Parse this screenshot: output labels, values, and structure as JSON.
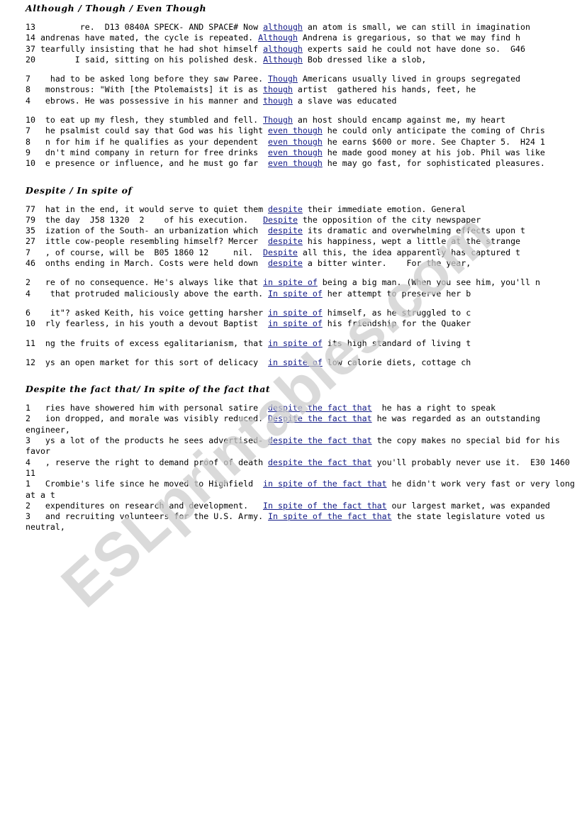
{
  "watermark": {
    "text": "ESLprintables.com",
    "color": "#cdcdcd"
  },
  "colors": {
    "keyword": "#121a86",
    "text": "#000000",
    "background": "#ffffff"
  },
  "sections": [
    {
      "title": "Although / Though / Even Though",
      "groups": [
        {
          "lines": [
            {
              "num": "13",
              "left": "         re.  D13 0840A SPECK- AND SPACE# Now ",
              "kw": "although",
              "right": " an atom is small, we can still in imagination"
            },
            {
              "num": "14",
              "left": " andrenas have mated, the cycle is repeated. ",
              "kw": "Although",
              "right": " Andrena is gregarious, so that we may find h"
            },
            {
              "num": "37",
              "left": " tearfully insisting that he had shot himself ",
              "kw": "although",
              "right": " experts said he could not have done so.  G46"
            },
            {
              "num": "20",
              "left": "        I said, sitting on his polished desk. ",
              "kw": "Although",
              "right": " Bob dressed like a slob,"
            }
          ]
        },
        {
          "lines": [
            {
              "num": "7",
              "left": "    had to be asked long before they saw Paree. ",
              "kw": "Though",
              "right": " Americans usually lived in groups segregated"
            },
            {
              "num": "8",
              "left": "   monstrous: \"With [the Ptolemaists] it is as ",
              "kw": "though",
              "right": " artist  gathered his hands, feet, he"
            },
            {
              "num": "4",
              "left": "   ebrows. He was possessive in his manner and ",
              "kw": "though",
              "right": " a slave was educated"
            }
          ]
        },
        {
          "lines": [
            {
              "num": "10",
              "left": "  to eat up my flesh, they stumbled and fell. ",
              "kw": "Though",
              "right": " an host should encamp against me, my heart"
            },
            {
              "num": "7",
              "left": "   he psalmist could say that God was his light ",
              "kw": "even though",
              "right": " he could only anticipate the coming of Chris"
            },
            {
              "num": "8",
              "left": "   n for him if he qualifies as your dependent  ",
              "kw": "even though",
              "right": " he earns $600 or more. See Chapter 5.  H24 1"
            },
            {
              "num": "9",
              "left": "   dn't mind company in return for free drinks  ",
              "kw": "even though",
              "right": " he made good money at his job. Phil was like"
            },
            {
              "num": "10",
              "left": "  e presence or influence, and he must go far  ",
              "kw": "even though",
              "right": " he may go fast, for sophisticated pleasures."
            }
          ]
        }
      ]
    },
    {
      "title": "Despite / In spite of",
      "groups": [
        {
          "lines": [
            {
              "num": "77",
              "left": "  hat in the end, it would serve to quiet them ",
              "kw": "despite",
              "right": " their immediate emotion. General"
            },
            {
              "num": "79",
              "left": "  the day  J58 1320  2    of his execution.   ",
              "kw": "Despite",
              "right": " the opposition of the city newspaper"
            },
            {
              "num": "35",
              "left": "  ization of the South- an urbanization which  ",
              "kw": "despite",
              "right": " its dramatic and overwhelming effects upon t"
            },
            {
              "num": "27",
              "left": "  ittle cow-people resembling himself? Mercer  ",
              "kw": "despite",
              "right": " his happiness, wept a little at the strange"
            },
            {
              "num": "7",
              "left": "   , of course, will be  B05 1860 12     nil.  ",
              "kw": "Despite",
              "right": " all this, the idea apparently has captured t"
            },
            {
              "num": "46",
              "left": "  onths ending in March. Costs were held down  ",
              "kw": "despite",
              "right": " a bitter winter.    For the year,"
            }
          ]
        },
        {
          "lines": [
            {
              "num": "2",
              "left": "   re of no consequence. He's always like that ",
              "kw": "in spite of",
              "right": " being a big man. (When you see him, you'll n"
            },
            {
              "num": "4",
              "left": "    that protruded maliciously above the earth. ",
              "kw": "In spite of",
              "right": " her attempt to preserve her b"
            }
          ]
        },
        {
          "lines": [
            {
              "num": "6",
              "left": "    it\"? asked Keith, his voice getting harsher ",
              "kw": "in spite of",
              "right": " himself, as he struggled to c"
            },
            {
              "num": "10",
              "left": "  rly fearless, in his youth a devout Baptist  ",
              "kw": "in spite of",
              "right": " his friendship for the Quaker"
            }
          ]
        },
        {
          "lines": [
            {
              "num": "11",
              "left": "  ng the fruits of excess egalitarianism, that ",
              "kw": "in spite of",
              "right": " its high standard of living t"
            }
          ]
        },
        {
          "lines": [
            {
              "num": "12",
              "left": "  ys an open market for this sort of delicacy  ",
              "kw": "in spite of",
              "right": " low calorie diets, cottage ch"
            }
          ]
        }
      ]
    },
    {
      "title": "Despite the fact that/ In spite of the fact that",
      "groups": [
        {
          "lines": [
            {
              "num": "1",
              "left": "   ries have showered him with personal satire  ",
              "kw": "despite the fact that",
              "right": "  he has a right to speak"
            },
            {
              "num": "2",
              "left": "   ion dropped, and morale was visibly reduced. ",
              "kw": "Despite the fact that",
              "right": " he was regarded as an outstanding engineer,"
            },
            {
              "num": "3",
              "left": "   ys a lot of the products he sees advertised- ",
              "kw": "despite the fact that",
              "right": " the copy makes no special bid for his favor"
            },
            {
              "num": "4",
              "left": "   , reserve the right to demand proof of death ",
              "kw": "despite the fact that",
              "right": " you'll probably never use it.  E30 1460 11"
            },
            {
              "num": "1",
              "left": "   Crombie's life since he moved to Highfield  ",
              "kw": "in spite of the fact that",
              "right": " he didn't work very fast or very long at a t"
            },
            {
              "num": "2",
              "left": "   expenditures on research and development.   ",
              "kw": "In spite of the fact that",
              "right": " our largest market, was expanded"
            },
            {
              "num": "3",
              "left": "   and recruiting volunteers for the U.S. Army. ",
              "kw": "In spite of the fact that",
              "right": " the state legislature voted us neutral,"
            }
          ]
        }
      ]
    }
  ]
}
